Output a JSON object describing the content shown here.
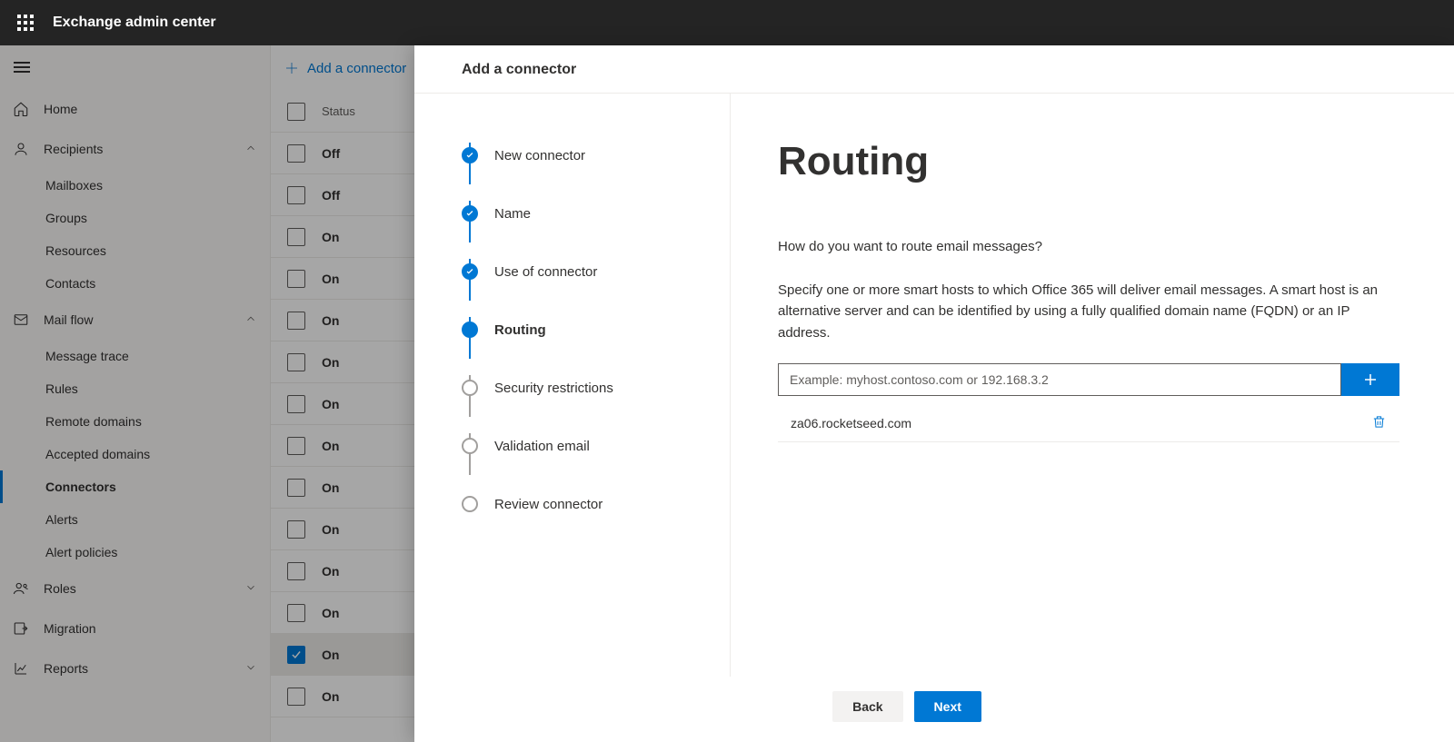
{
  "header": {
    "title": "Exchange admin center"
  },
  "sidebar": {
    "items": [
      {
        "label": "Home",
        "type": "item",
        "icon": "home"
      },
      {
        "label": "Recipients",
        "type": "group",
        "icon": "person",
        "expanded": true
      },
      {
        "label": "Mailboxes",
        "type": "sub"
      },
      {
        "label": "Groups",
        "type": "sub"
      },
      {
        "label": "Resources",
        "type": "sub"
      },
      {
        "label": "Contacts",
        "type": "sub"
      },
      {
        "label": "Mail flow",
        "type": "group",
        "icon": "mail",
        "expanded": true
      },
      {
        "label": "Message trace",
        "type": "sub"
      },
      {
        "label": "Rules",
        "type": "sub"
      },
      {
        "label": "Remote domains",
        "type": "sub"
      },
      {
        "label": "Accepted domains",
        "type": "sub"
      },
      {
        "label": "Connectors",
        "type": "sub",
        "active": true
      },
      {
        "label": "Alerts",
        "type": "sub"
      },
      {
        "label": "Alert policies",
        "type": "sub"
      },
      {
        "label": "Roles",
        "type": "group",
        "icon": "roles",
        "expanded": false
      },
      {
        "label": "Migration",
        "type": "item",
        "icon": "migrate"
      },
      {
        "label": "Reports",
        "type": "group",
        "icon": "reports",
        "expanded": false
      }
    ]
  },
  "toolbar": {
    "add_label": "Add a connector"
  },
  "list": {
    "header": {
      "status": "Status"
    },
    "rows": [
      {
        "status": "Off",
        "checked": false
      },
      {
        "status": "Off",
        "checked": false
      },
      {
        "status": "On",
        "checked": false
      },
      {
        "status": "On",
        "checked": false
      },
      {
        "status": "On",
        "checked": false
      },
      {
        "status": "On",
        "checked": false
      },
      {
        "status": "On",
        "checked": false
      },
      {
        "status": "On",
        "checked": false
      },
      {
        "status": "On",
        "checked": false
      },
      {
        "status": "On",
        "checked": false
      },
      {
        "status": "On",
        "checked": false
      },
      {
        "status": "On",
        "checked": false
      },
      {
        "status": "On",
        "checked": true
      },
      {
        "status": "On",
        "checked": false
      }
    ]
  },
  "panel": {
    "title": "Add a connector",
    "steps": [
      {
        "label": "New connector",
        "state": "done"
      },
      {
        "label": "Name",
        "state": "done"
      },
      {
        "label": "Use of connector",
        "state": "done"
      },
      {
        "label": "Routing",
        "state": "current"
      },
      {
        "label": "Security restrictions",
        "state": "pending"
      },
      {
        "label": "Validation email",
        "state": "pending"
      },
      {
        "label": "Review connector",
        "state": "pending"
      }
    ],
    "content": {
      "heading": "Routing",
      "question": "How do you want to route email messages?",
      "description": "Specify one or more smart hosts to which Office 365 will deliver email messages. A smart host is an alternative server and can be identified by using a fully qualified domain name (FQDN) or an IP address.",
      "placeholder": "Example: myhost.contoso.com or 192.168.3.2",
      "hosts": [
        {
          "value": "za06.rocketseed.com"
        }
      ]
    },
    "footer": {
      "back": "Back",
      "next": "Next"
    }
  }
}
